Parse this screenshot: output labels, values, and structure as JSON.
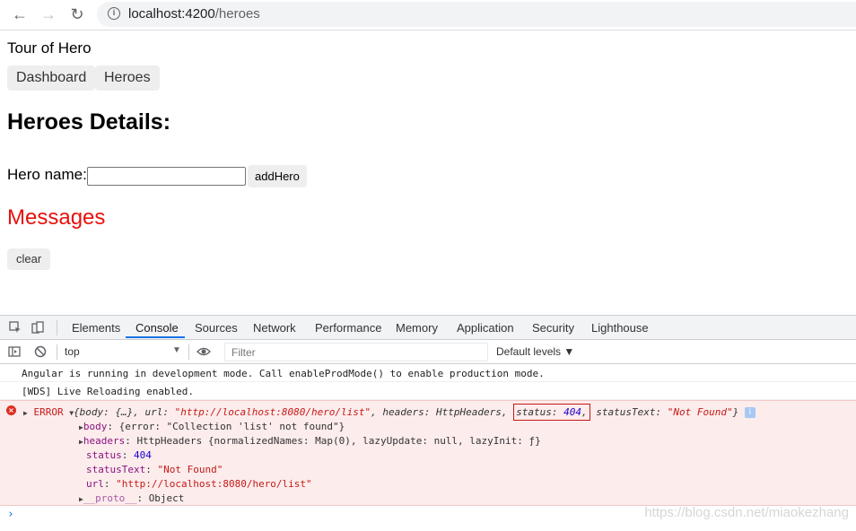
{
  "browser": {
    "back_icon": "←",
    "forward_icon": "→",
    "reload_icon": "↻",
    "info_icon": "i",
    "url_host": "localhost:4200",
    "url_path": "/heroes"
  },
  "app": {
    "title": "Tour of Hero",
    "nav": [
      "Dashboard",
      "Heroes"
    ],
    "details_heading": "Heroes Details:",
    "hero_name_label": "Hero name:",
    "hero_name_value": "",
    "add_button": "addHero",
    "messages_heading": "Messages",
    "clear_button": "clear",
    "messages_color": "#e6120c"
  },
  "devtools": {
    "tabs": [
      "Elements",
      "Console",
      "Sources",
      "Network",
      "Performance",
      "Memory",
      "Application",
      "Security",
      "Lighthouse"
    ],
    "active_tab": "Console",
    "context": "top",
    "filter_placeholder": "Filter",
    "levels": "Default levels ▼",
    "logs": [
      "Angular is running in development mode. Call enableProdMode() to enable production mode.",
      "[WDS] Live Reloading enabled."
    ],
    "error": {
      "label": "ERROR",
      "summary": {
        "body": "{…}",
        "url": "\"http://localhost:8080/hero/list\"",
        "headers": "HttpHeaders",
        "status": "404",
        "statusText": "\"Not Found\""
      },
      "body_line": "{error: \"Collection 'list' not found\"}",
      "headers_line": "HttpHeaders {normalizedNames: Map(0), lazyUpdate: null, lazyInit: ƒ}",
      "status": "404",
      "statusText": "\"Not Found\"",
      "url": "\"http://localhost:8080/hero/list\"",
      "proto": "Object"
    },
    "prompt": "›"
  },
  "watermark": "https://blog.csdn.net/miaokezhang"
}
